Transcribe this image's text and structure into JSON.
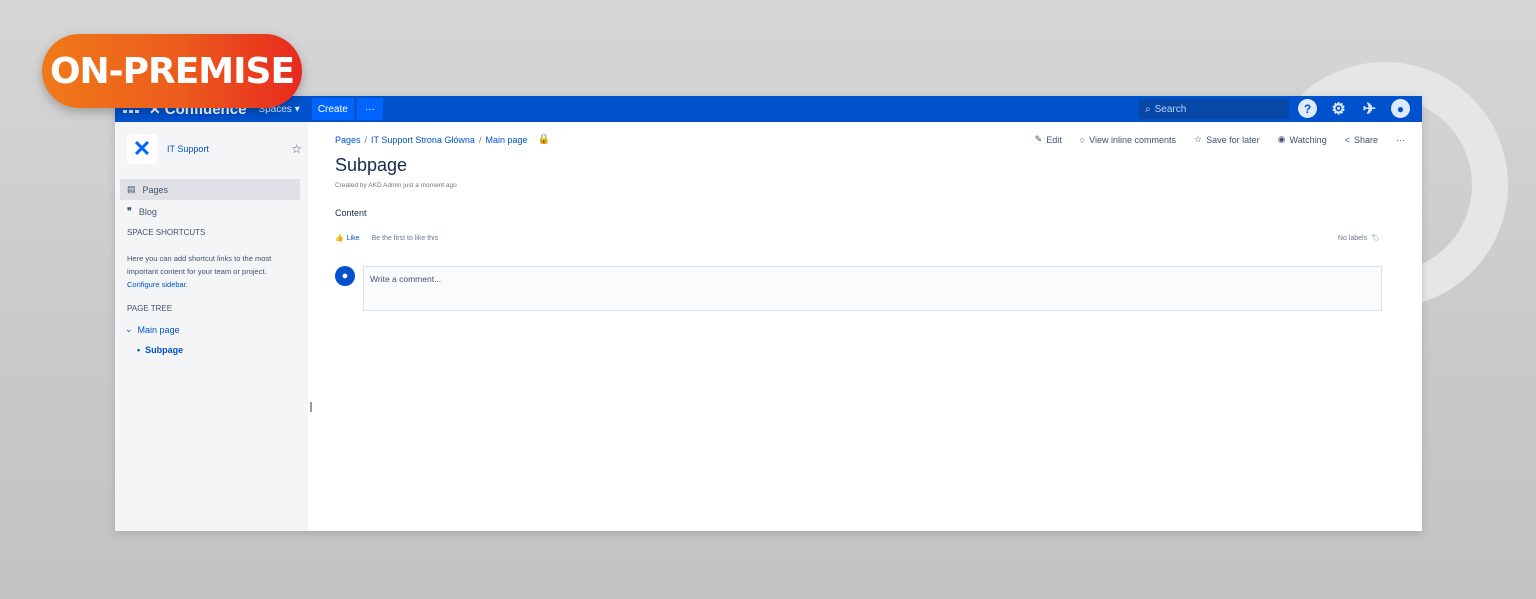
{
  "badge": "ON-PREMISE",
  "topbar": {
    "logo": "Confluence",
    "spaces": "Spaces",
    "create": "Create",
    "more": "···",
    "search_placeholder": "Search"
  },
  "sidebar": {
    "space_name": "IT Support",
    "items": [
      {
        "label": "Pages",
        "icon": "pages-icon"
      },
      {
        "label": "Blog",
        "icon": "quote-icon"
      }
    ],
    "shortcuts_title": "SPACE SHORTCUTS",
    "shortcuts_text": "Here you can add shortcut links to the most important content for your team or project.",
    "configure_link": "Configure sidebar.",
    "tree_title": "PAGE TREE",
    "tree": [
      {
        "label": "Main page"
      },
      {
        "label": "Subpage"
      }
    ]
  },
  "page": {
    "breadcrumb": [
      "Pages",
      "IT Support Strona Główna",
      "Main page"
    ],
    "actions": {
      "edit": "Edit",
      "inline_comments": "View inline comments",
      "save_later": "Save for later",
      "watching": "Watching",
      "share": "Share",
      "more": "···"
    },
    "title": "Subpage",
    "byline": "Created by AKD Admin just a moment ago",
    "content": "Content",
    "like": "Like",
    "first_like": "Be the first to like this",
    "labels": "No labels",
    "comment_placeholder": "Write a comment..."
  }
}
